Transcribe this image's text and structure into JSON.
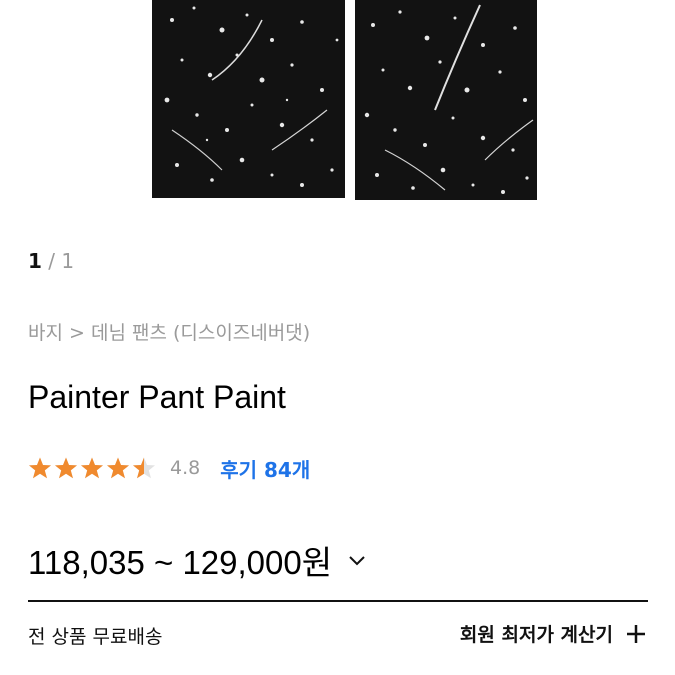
{
  "gallery": {
    "current": "1",
    "separator": "/",
    "total": "1"
  },
  "breadcrumb": "바지 > 데님 팬츠 (디스이즈네버댓)",
  "product": {
    "name": "Painter Pant Paint"
  },
  "rating": {
    "stars": 4.5,
    "max": 5,
    "score": "4.8",
    "reviews_label": "후기 84개",
    "star_color": "#f08a2e",
    "reviews_color": "#1e73e8"
  },
  "price": {
    "range": "118,035 ~ 129,000원"
  },
  "footer": {
    "shipping": "전 상품 무료배송",
    "calculator": "회원 최저가 계산기"
  },
  "icons": {
    "price_toggle": "chevron-down-icon",
    "calculator_toggle": "plus-icon"
  }
}
